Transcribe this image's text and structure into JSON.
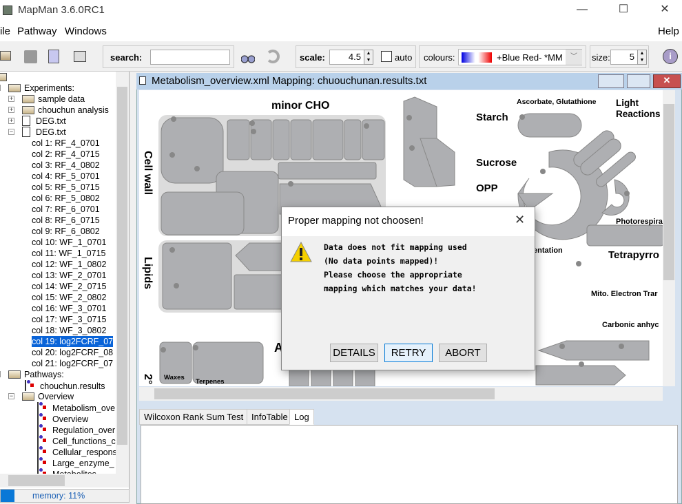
{
  "window": {
    "title": "MapMan 3.6.0RC1",
    "minimize": "—",
    "maximize": "☐",
    "close": "✕"
  },
  "menu": [
    "ile",
    "Pathway",
    "Windows",
    "Help"
  ],
  "toolbar": {
    "search_label": "search:",
    "search_value": "",
    "scale_label": "scale:",
    "scale_value": "4.5",
    "auto_label": "auto",
    "auto_checked": false,
    "colours_label": "colours:",
    "colours_value": "+Blue Red- *MM",
    "size_label": "size:",
    "size_value": "5"
  },
  "tree": {
    "experiments_label": "Experiments:",
    "experiments": [
      "sample data",
      "chouchun analysis",
      "DEG.txt",
      "DEG.txt"
    ],
    "columns": [
      "col 1: RF_4_0701",
      "col 2: RF_4_0715",
      "col 3: RF_4_0802",
      "col 4: RF_5_0701",
      "col 5: RF_5_0715",
      "col 6: RF_5_0802",
      "col 7: RF_6_0701",
      "col 8: RF_6_0715",
      "col 9: RF_6_0802",
      "col 10: WF_1_0701",
      "col 11: WF_1_0715",
      "col 12: WF_1_0802",
      "col 13: WF_2_0701",
      "col 14: WF_2_0715",
      "col 15: WF_2_0802",
      "col 16: WF_3_0701",
      "col 17: WF_3_0715",
      "col 18: WF_3_0802",
      "col 19: log2FCRF_07",
      "col 20: log2FCRF_08",
      "col 21: log2FCRF_07"
    ],
    "selected_column": 18,
    "pathways_label": "Pathways:",
    "pathways_file": "chouchun.results",
    "overview_label": "Overview",
    "overview_items": [
      "Metabolism_ove",
      "Overview",
      "Regulation_over",
      "Cell_functions_c",
      "Cellular_respons",
      "Large_enzyme_",
      "Metabolites"
    ]
  },
  "memory": {
    "label": "memory: 11%",
    "percent": 11
  },
  "frame": {
    "title": "Metabolism_overview.xml Mapping: chuouchunan.results.txt"
  },
  "diagram": {
    "labels": {
      "minor_cho": "minor CHO",
      "cell_wall": "Cell wall",
      "lipids": "Lipids",
      "starch": "Starch",
      "sucrose": "Sucrose",
      "opp": "OPP",
      "ascorbate": "Ascorbate, Glutathione",
      "light": "Light",
      "reactions": "Reactions",
      "photoresp": "Photorespira",
      "fermentation": "entation",
      "tetrapyrrole": "Tetrapyrro",
      "mito": "Mito. Electron Trar",
      "carbonic": "Carbonic anhyc",
      "waxes": "Waxes",
      "terpenes": "Terpenes",
      "secondary": "2°",
      "aa": "A"
    }
  },
  "tabs": [
    "Wilcoxon Rank Sum Test",
    "InfoTable",
    "Log"
  ],
  "active_tab": 2,
  "dialog": {
    "title": "Proper mapping not choosen!",
    "lines": [
      "Data does not fit mapping used",
      "(No data points mapped)!",
      "Please choose the appropriate",
      "mapping which matches your data!"
    ],
    "buttons": [
      "DETAILS",
      "RETRY",
      "ABORT"
    ],
    "default_button": "RETRY",
    "icon": "warning-icon"
  }
}
